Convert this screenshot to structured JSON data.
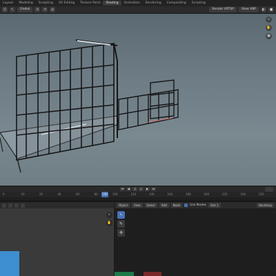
{
  "workspace_tabs": [
    "Layout",
    "Modeling",
    "Sculpting",
    "UV Editing",
    "Texture Paint",
    "Shading",
    "Animation",
    "Rendering",
    "Compositing",
    "Scripting"
  ],
  "active_tab_index": 5,
  "viewport_header": {
    "transform_orientation": "Global",
    "render_engine": "Render VRTSP",
    "view_layer": "View VBP"
  },
  "timeline": {
    "current_frame": "100",
    "ruler_ticks": [
      "0",
      "10",
      "20",
      "40",
      "60",
      "80",
      "100",
      "120",
      "140",
      "160",
      "180",
      "200",
      "220",
      "240",
      "250"
    ]
  },
  "node_editor": {
    "object_menu": "Object",
    "menus": [
      "View",
      "Select",
      "Add",
      "Node"
    ],
    "use_nodes_label": "Use Nodes",
    "slot": "Slot 1",
    "material": "Backdrop"
  },
  "colors": {
    "accent": "#4772b3",
    "thumb": "#3d8fd1",
    "node_green": "#1f7a4a",
    "node_red": "#7a2a2a"
  }
}
